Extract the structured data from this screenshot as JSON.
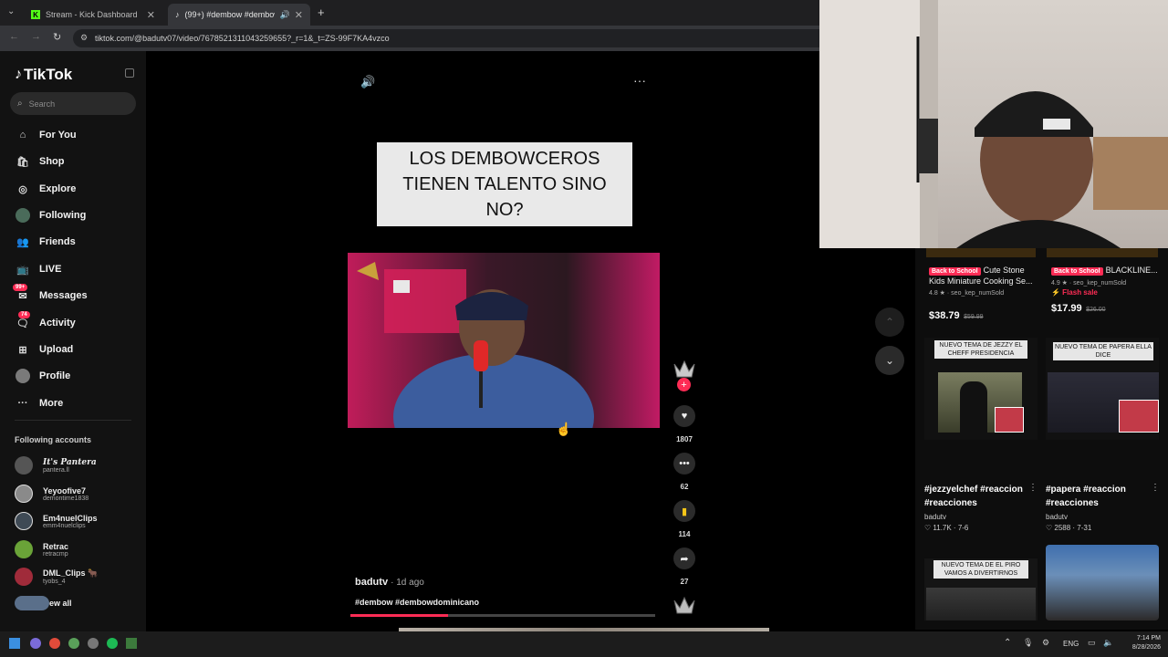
{
  "browser": {
    "tabs": [
      {
        "label": "Stream - Kick Dashboard"
      },
      {
        "label": "(99+) #dembow #dembowd"
      }
    ],
    "url": "tiktok.com/@badutv07/video/7678521311043259655?_r=1&_t=ZS-99F7KA4vzco"
  },
  "sidebar": {
    "logo": "TikTok",
    "search_placeholder": "Search",
    "items": [
      {
        "label": "For You"
      },
      {
        "label": "Shop"
      },
      {
        "label": "Explore"
      },
      {
        "label": "Following"
      },
      {
        "label": "Friends"
      },
      {
        "label": "LIVE"
      },
      {
        "label": "Messages",
        "badge": "99+"
      },
      {
        "label": "Activity",
        "badge": "74"
      },
      {
        "label": "Upload"
      },
      {
        "label": "Profile"
      },
      {
        "label": "More"
      }
    ],
    "following_title": "Following accounts",
    "accounts": [
      {
        "name": "It's Pantera",
        "handle": "pantera.ll"
      },
      {
        "name": "Yeyoofive7",
        "handle": "demontime1838"
      },
      {
        "name": "Em4nuelClips",
        "handle": "emm4nuelclips"
      },
      {
        "name": "Retrac",
        "handle": "retracmp"
      },
      {
        "name": "DML_Clips 🐂",
        "handle": "tyobs_4"
      }
    ],
    "see_all": "ew all"
  },
  "video": {
    "caption_text": "LOS DEMBOWCEROS TIENEN TALENTO SINO NO?",
    "author": "badutv",
    "time_ago": "· 1d ago",
    "hashtags": "#dembow #dembowdominicano",
    "likes": "1807",
    "comments": "62",
    "saves": "114",
    "shares": "27",
    "progress_fraction": 0.32
  },
  "right_column": {
    "products": [
      {
        "tag": "Back to School",
        "title": "Cute Stone Kids Miniature Cooking Se...",
        "rating": "4.8 ★ · seo_kep_numSold",
        "price": "$38.79",
        "old_price": "$59.99"
      },
      {
        "tag": "Back to School",
        "title": "BLACKLINE...",
        "rating": "4.9 ★ · seo_kep_numSold",
        "flash": "⚡ Flash sale",
        "price": "$17.99",
        "old_price": "$26.00"
      }
    ],
    "videos": [
      {
        "thumb_text": "NUEVO TEMA DE JEZZY EL CHEFF PRESIDENCIA",
        "title": "#jezzyelchef #reaccion #reacciones",
        "author": "badutv",
        "stats": "♡ 11.7K · 7-6"
      },
      {
        "thumb_text": "NUEVO TEMA DE PAPERA ELLA DICE",
        "title": "#papera #reaccion #reacciones",
        "author": "badutv",
        "stats": "♡ 2588 · 7-31"
      },
      {
        "thumb_text": "NUEVO TEMA DE EL PIRO VAMOS A DIVERTIRNOS"
      }
    ]
  },
  "taskbar": {
    "lang": "ENG",
    "time": "7:14 PM",
    "date": "8/28/2026"
  },
  "colors": {
    "tiktok_red": "#fe2c55",
    "save_yellow": "#f5c518"
  }
}
